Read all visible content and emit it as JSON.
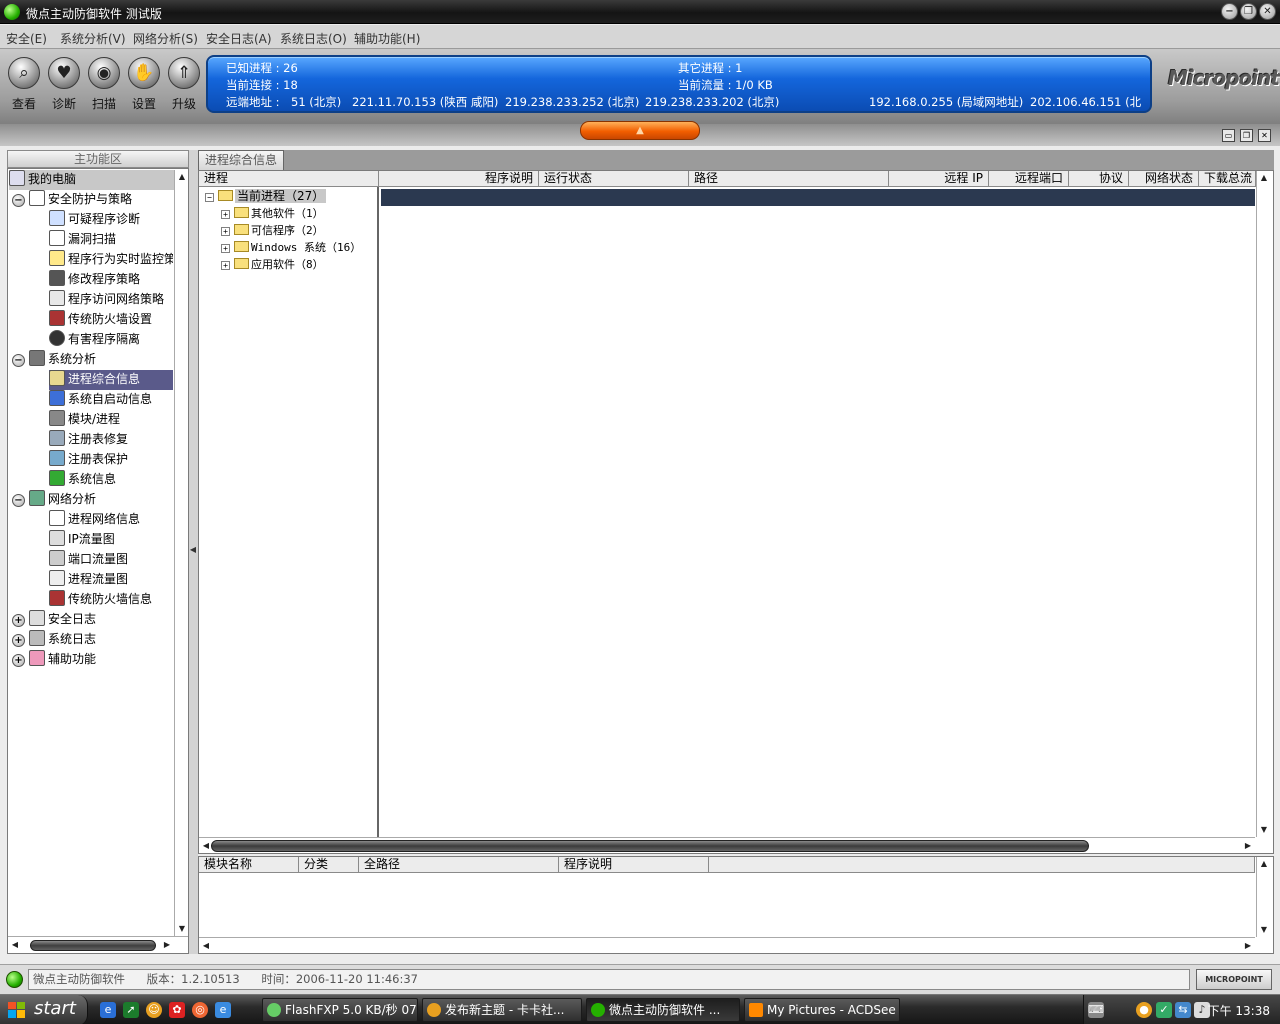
{
  "window": {
    "title": "微点主动防御软件  测试版",
    "controls": {
      "minimize": "−",
      "restore": "❐",
      "close": "✕"
    }
  },
  "menu": [
    "安全(E)",
    "系统分析(V)",
    "网络分析(S)",
    "安全日志(A)",
    "系统日志(O)",
    "辅助功能(H)"
  ],
  "toolbar": {
    "buttons": [
      {
        "label": "查看",
        "icon": "magnifier-icon"
      },
      {
        "label": "诊断",
        "icon": "heart-icon"
      },
      {
        "label": "扫描",
        "icon": "scan-icon"
      },
      {
        "label": "设置",
        "icon": "hand-icon"
      },
      {
        "label": "升级",
        "icon": "upgrade-icon"
      }
    ]
  },
  "info": {
    "known_processes": "已知进程 : 26",
    "other_processes": "其它进程 : 1",
    "current_connections": "当前连接 : 18",
    "current_traffic": "当前流量 : 1/0 KB",
    "remote_label": "远端地址 :",
    "remote_addresses": [
      "51 (北京)",
      "221.11.70.153 (陕西 咸阳)",
      "219.238.233.252 (北京)",
      "219.238.233.202 (北京)",
      "192.168.0.255 (局域网地址)",
      "202.106.46.151 (北"
    ]
  },
  "logo": "Micropoint",
  "left_panel": {
    "header": "主功能区",
    "tree": {
      "root": "我的电脑",
      "groups": [
        {
          "label": "安全防护与策略",
          "expanded": true,
          "items": [
            "可疑程序诊断",
            "漏洞扫描",
            "程序行为实时监控策略",
            "修改程序策略",
            "程序访问网络策略",
            "传统防火墙设置",
            "有害程序隔离"
          ]
        },
        {
          "label": "系统分析",
          "expanded": true,
          "items": [
            "进程综合信息",
            "系统自启动信息",
            "模块/进程",
            "注册表修复",
            "注册表保护",
            "系统信息"
          ]
        },
        {
          "label": "网络分析",
          "expanded": true,
          "items": [
            "进程网络信息",
            "IP流量图",
            "端口流量图",
            "进程流量图",
            "传统防火墙信息"
          ]
        },
        {
          "label": "安全日志",
          "expanded": false,
          "items": []
        },
        {
          "label": "系统日志",
          "expanded": false,
          "items": []
        },
        {
          "label": "辅助功能",
          "expanded": false,
          "items": []
        }
      ],
      "selected": "进程综合信息"
    }
  },
  "main": {
    "tab": "进程综合信息",
    "columns": [
      "进程",
      "程序说明",
      "运行状态",
      "路径",
      "远程 IP",
      "远程端口",
      "协议",
      "网络状态",
      "下载总流"
    ],
    "process_tree": {
      "root": "当前进程（27）",
      "children": [
        "其他软件（1）",
        "可信程序（2）",
        "Windows 系统（16）",
        "应用软件（8）"
      ]
    },
    "module_columns": [
      "模块名称",
      "分类",
      "全路径",
      "程序说明"
    ]
  },
  "status": {
    "app": "微点主动防御软件",
    "version": "版本：1.2.10513",
    "time": "时间：2006-11-20  11:46:37",
    "small_logo": "MICROPOINT"
  },
  "taskbar": {
    "start": "start",
    "tasks": [
      "FlashFXP 5.0 KB/秒 07...",
      "发布新主题 - 卡卡社...",
      "微点主动防御软件  ...",
      "My Pictures - ACDSee ..."
    ],
    "active_task": 2,
    "clock": "下午 13:38"
  },
  "colors": {
    "accent_blue": "#1466dc",
    "collapse_orange": "#f25e00",
    "selection": "#5a5a8a",
    "proc_selection": "#2b3950"
  }
}
